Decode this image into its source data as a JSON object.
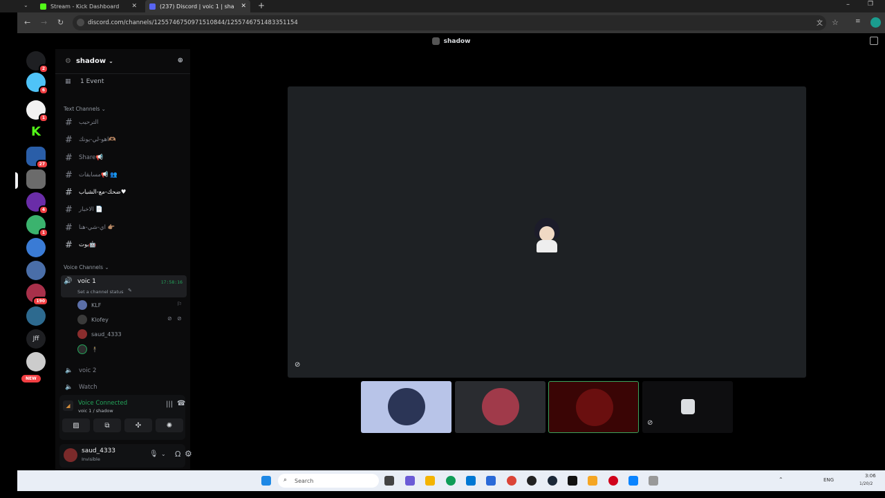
{
  "browser": {
    "tabs": [
      {
        "title": "Stream - Kick Dashboard",
        "active": false,
        "favicon_color": "#53fc18"
      },
      {
        "title": "(237) Discord | voic 1 | sha",
        "active": true,
        "favicon_color": "#5865f2"
      }
    ],
    "url": "discord.com/channels/1255746750971510844/1255746751483351154"
  },
  "discord": {
    "title_bar": "shadow",
    "server_name": "shadow",
    "events_label": "1 Event",
    "text_category": "Text Channels",
    "text_channels": [
      {
        "name": "الترحيب"
      },
      {
        "name": "اهو-لي-يونك🫶🏽"
      },
      {
        "name": "Share📢"
      },
      {
        "name": "مسابقات📢 👥"
      },
      {
        "name": "ضحك-مع-الشباب♥"
      },
      {
        "name": "الاخبار 📄"
      },
      {
        "name": "اي-شي-هنا 👉🏽"
      },
      {
        "name": "بوت🤖"
      }
    ],
    "voice_category": "Voice Channels",
    "active_voice": {
      "name": "voic 1",
      "timer": "17:58:16",
      "status_placeholder": "Set a channel status"
    },
    "members": [
      {
        "name": "KLF"
      },
      {
        "name": "Klofey"
      },
      {
        "name": "saud_4333"
      },
      {
        "name": "🕴"
      }
    ],
    "other_voice": [
      {
        "name": "voic 2"
      },
      {
        "name": "Watch"
      }
    ],
    "guild_badges": [
      "2",
      "6",
      "1",
      "27",
      "4",
      "1",
      "190"
    ],
    "guild_label_jff": "Jff",
    "new_badge": "NEW",
    "voice_panel": {
      "status": "Voice Connected",
      "location": "voic 1 / shadow"
    },
    "user": {
      "name": "saud_4333",
      "status": "Invisible"
    }
  },
  "taskbar": {
    "search_placeholder": "Search",
    "lang": "ENG",
    "time": "3:06",
    "date": "1/20/2"
  },
  "colors": {
    "connected_green": "#23a55a",
    "badge_red": "#f23f43",
    "stage_bg": "#1e2124",
    "speaking_border": "#3ba55d"
  }
}
